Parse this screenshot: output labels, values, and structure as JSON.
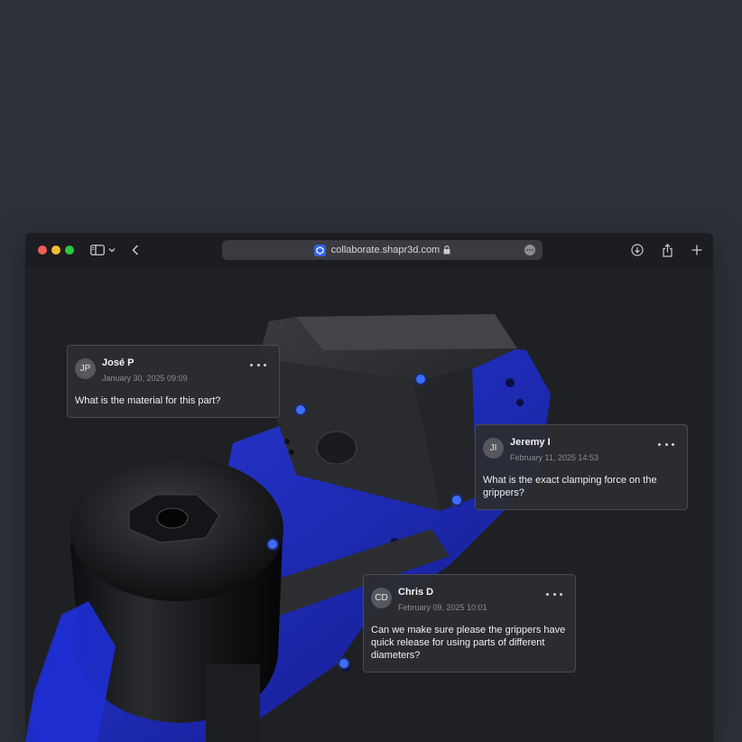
{
  "browser": {
    "url": "collaborate.shapr3d.com"
  },
  "comments": [
    {
      "initials": "JP",
      "name": "José P",
      "date": "January 30, 2025 09:09",
      "text": "What is the material for this part?"
    },
    {
      "initials": "JI",
      "name": "Jeremy I",
      "date": "February 11, 2025 14:53",
      "text": "What is the exact clamping force on the grippers?"
    },
    {
      "initials": "CD",
      "name": "Chris D",
      "date": "February 09, 2025 10:01",
      "text": "Can we make sure please the grippers have quick release for using parts of different diameters?"
    }
  ],
  "colors": {
    "accent": "#3d6dff",
    "part_blue": "#1d2bb8",
    "part_black": "#111214"
  },
  "icons": [
    "sidebar-icon",
    "chevron-down-icon",
    "back-icon",
    "lock-icon",
    "more-icon",
    "download-icon",
    "share-icon",
    "plus-icon"
  ]
}
